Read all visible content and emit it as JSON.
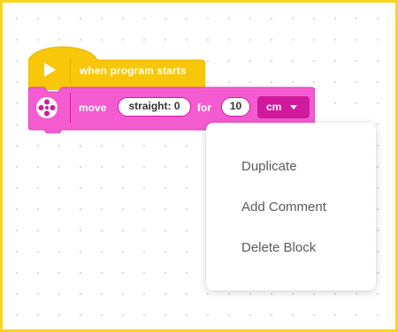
{
  "hat_block": {
    "label": "when program starts",
    "icon": "play-icon",
    "color": "#f9c70a"
  },
  "move_block": {
    "label": "move",
    "icon": "drive-base-icon",
    "color": "#f55bd0",
    "direction_value": "straight: 0",
    "for_label": "for",
    "distance_value": "10",
    "unit_value": "cm"
  },
  "context_menu": {
    "items": [
      {
        "label": "Duplicate"
      },
      {
        "label": "Add Comment"
      },
      {
        "label": "Delete Block"
      }
    ]
  },
  "colors": {
    "frame_border": "#f9d51f",
    "hat_block": "#f9c70a",
    "move_block": "#f55bd0",
    "menu_text": "#5a5a5a"
  }
}
